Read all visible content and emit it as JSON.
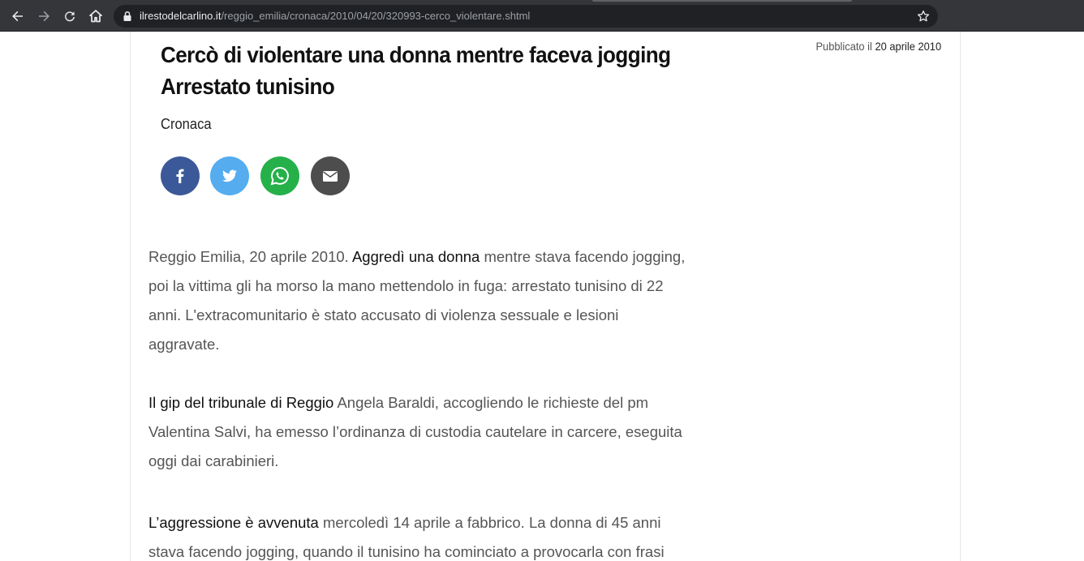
{
  "browser": {
    "url_domain": "ilrestodelcarlino.it",
    "url_path": "/reggio_emilia/cronaca/2010/04/20/320993-cerco_violentare.shtml",
    "icons": [
      "back-arrow-icon",
      "forward-arrow-icon",
      "reload-icon",
      "home-icon",
      "lock-icon",
      "star-icon"
    ]
  },
  "article": {
    "headline": "Cercò di violentare una donna mentre faceva jogging Arrestato tunisino",
    "published_label": "Pubblicato il",
    "published_date": "20 aprile 2010",
    "section": "Cronaca",
    "share": {
      "icons": [
        "facebook-icon",
        "twitter-icon",
        "whatsapp-icon",
        "email-icon"
      ],
      "colors": {
        "facebook": "#3b5998",
        "twitter": "#55acee",
        "whatsapp": "#25b04a",
        "email": "#4d4d4d"
      }
    },
    "paragraphs": [
      {
        "lead": "Reggio Emilia, 20 aprile 2010.",
        "bold": "Aggredì una donna",
        "rest": "mentre stava facendo jogging, poi la vittima gli ha morso la mano mettendolo in fuga: arrestato tunisino di 22 anni. L'extracomunitario è stato accusato di violenza sessuale e lesioni aggravate."
      },
      {
        "bold": "Il gip del tribunale di Reggio",
        "rest": "Angela Baraldi, accogliendo le richieste del pm Valentina Salvi, ha emesso l’ordinanza di custodia cautelare in carcere, eseguita oggi dai carabinieri."
      },
      {
        "bold": "L’aggressione è avvenuta",
        "rest": "mercoledì 14 aprile a fabbrico. La donna di 45 anni stava facendo jogging, quando il tunisino ha cominciato a provocarla con frasi"
      }
    ]
  }
}
